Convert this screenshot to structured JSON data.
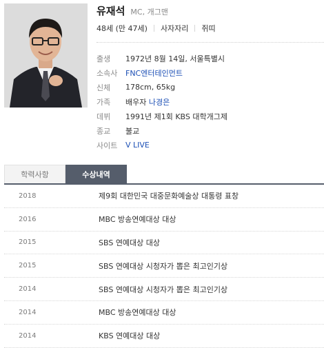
{
  "person": {
    "name": "유재석",
    "job": "MC, 개그맨",
    "meta": [
      "48세 (만 47세)",
      "사자자리",
      "쥐띠"
    ]
  },
  "details": [
    {
      "label": "출생",
      "value": "1972년 8월 14일, 서울특별시"
    },
    {
      "label": "소속사",
      "value": "FNC엔터테인먼트"
    },
    {
      "label": "신체",
      "value": "178cm, 65kg"
    },
    {
      "label": "가족",
      "value_prefix": "배우자",
      "value": "나경은"
    },
    {
      "label": "데뷔",
      "value": "1991년 제1회 KBS 대학개그제"
    },
    {
      "label": "종교",
      "value": "불교"
    },
    {
      "label": "사이트",
      "value": "V LIVE"
    }
  ],
  "tabs": [
    {
      "label": "학력사항",
      "active": false
    },
    {
      "label": "수상내역",
      "active": true
    }
  ],
  "awards": [
    {
      "year": "2018",
      "title": "제9회 대한민국 대중문화예술상 대통령 표창"
    },
    {
      "year": "2016",
      "title": "MBC 방송연예대상 대상"
    },
    {
      "year": "2015",
      "title": "SBS 연예대상 대상"
    },
    {
      "year": "2015",
      "title": "SBS 연예대상 시청자가 뽑은 최고인기상"
    },
    {
      "year": "2014",
      "title": "SBS 연예대상 시청자가 뽑은 최고인기상"
    },
    {
      "year": "2014",
      "title": "MBC 방송연예대상 대상"
    },
    {
      "year": "2014",
      "title": "KBS 연예대상 대상"
    }
  ],
  "colors": {
    "accent": "#555d6b",
    "link": "#1c4fb5"
  },
  "icons": {
    "photo": "person-photo"
  }
}
